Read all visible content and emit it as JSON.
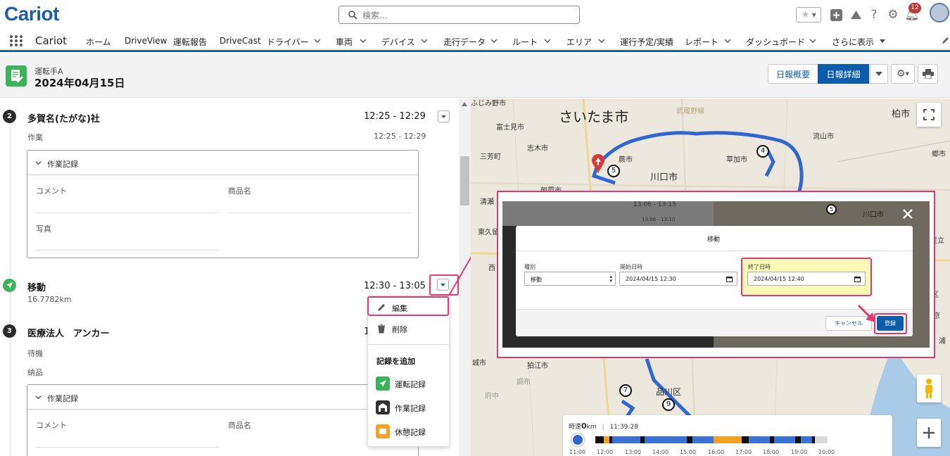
{
  "header": {
    "logo": "Cariot",
    "search_placeholder": "検索...",
    "notification_count": "12"
  },
  "nav": {
    "app_name": "Cariot",
    "items": [
      {
        "label": "ホーム"
      },
      {
        "label": "DriveView"
      },
      {
        "label": "運転報告"
      },
      {
        "label": "DriveCast"
      },
      {
        "label": "ドライバー"
      },
      {
        "label": "車両"
      },
      {
        "label": "デバイス"
      },
      {
        "label": "走行データ"
      },
      {
        "label": "ルート"
      },
      {
        "label": "エリア"
      },
      {
        "label": "運行予定/実績"
      },
      {
        "label": "レポート"
      },
      {
        "label": "ダッシュボード"
      },
      {
        "label": "さらに表示"
      }
    ]
  },
  "page": {
    "driver": "運転手A",
    "date": "2024年04月15日",
    "btn_summary": "日報概要",
    "btn_detail": "日報詳細"
  },
  "stops": {
    "s2": {
      "num": "2",
      "title": "多賀名(たがな)社",
      "time": "12:25 - 12:29",
      "sub": "作業",
      "sub_time": "12:25 - 12:29"
    },
    "move": {
      "title": "移動",
      "time": "12:30 - 13:05",
      "distance": "16.7782km"
    },
    "s3": {
      "num": "3",
      "title": "医療法人　アンカー",
      "time_partial": "1",
      "sub1": "待機",
      "sub2": "納品"
    }
  },
  "card": {
    "header": "作業記録",
    "comment": "コメント",
    "product": "商品名",
    "photo": "写真"
  },
  "menu": {
    "edit": "編集",
    "delete": "削除",
    "add_section": "記録を追加",
    "drive_record": "運転記録",
    "work_record": "作業記録",
    "rest_record": "休憩記録"
  },
  "map": {
    "city_big1": "さいたま市",
    "city_big2": "川口市",
    "labels": [
      "ふじみ野市",
      "富士見市",
      "志木市",
      "三芳町",
      "朝霞市",
      "蕨市",
      "草加市",
      "柏市",
      "流山市",
      "武蔵野線",
      "清瀬",
      "東久留",
      "西",
      "城市",
      "狛江市",
      "品川区",
      "調布",
      "府中",
      "足立",
      "区",
      "東京",
      "浦",
      "郷市"
    ],
    "speed_label": "時速",
    "speed_value": "0",
    "speed_unit": "km",
    "speed_time": "11:39:28",
    "timeline_ticks": [
      "11:00",
      "12:00",
      "13:00",
      "14:00",
      "15:00",
      "16:00",
      "17:00",
      "18:00",
      "19:00",
      "20:00"
    ]
  },
  "dialog": {
    "title": "移動",
    "type_label": "種別",
    "type_value": "移動",
    "start_label": "開始日時",
    "start_value": "2024/04/15 12:30",
    "end_label": "終了日時",
    "end_value": "2024/04/15 12:40",
    "cancel": "キャンセル",
    "submit": "登録",
    "bg_time": "13:06 - 13:15",
    "bg_time2": "13:06 - 13:10",
    "bg_city": "川口市"
  },
  "colors": {
    "brand": "#1b5fa8",
    "highlight": "#e03a74",
    "route": "#2f66d0",
    "green": "#3bb35a"
  }
}
